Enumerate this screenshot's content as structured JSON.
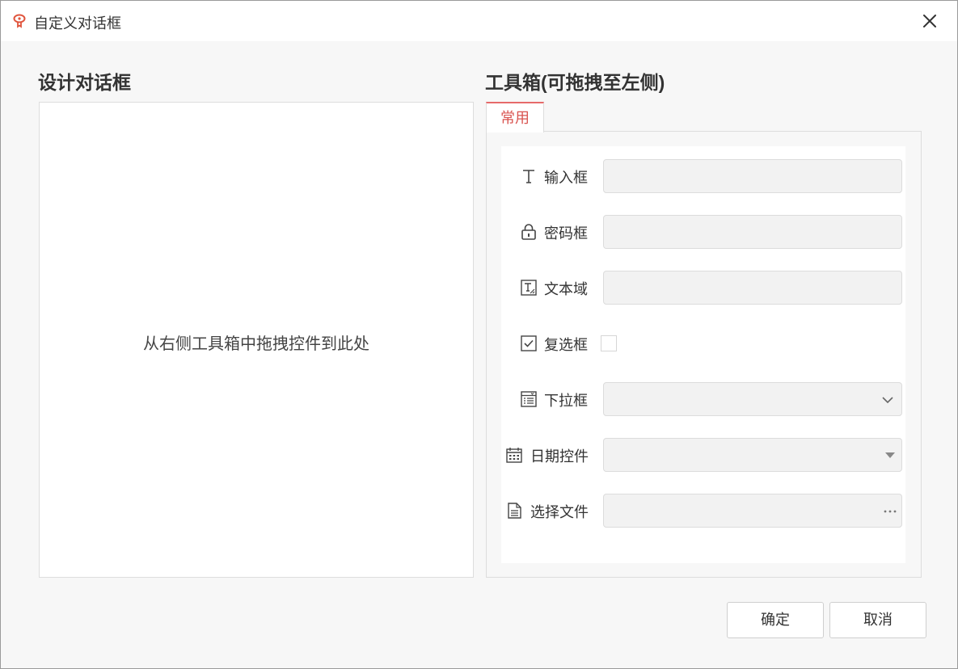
{
  "window": {
    "title": "自定义对话框"
  },
  "design": {
    "title": "设计对话框",
    "hint": "从右侧工具箱中拖拽控件到此处"
  },
  "toolbox": {
    "title": "工具箱(可拖拽至左侧)",
    "active_tab": "常用",
    "accent_color": "#e66a6a",
    "items": [
      {
        "label": "输入框",
        "icon": "text-T-icon"
      },
      {
        "label": "密码框",
        "icon": "lock-icon"
      },
      {
        "label": "文本域",
        "icon": "textarea-icon"
      },
      {
        "label": "复选框",
        "icon": "checkbox-icon"
      },
      {
        "label": "下拉框",
        "icon": "dropdown-list-icon"
      },
      {
        "label": "日期控件",
        "icon": "calendar-icon"
      },
      {
        "label": "选择文件",
        "icon": "file-icon"
      }
    ]
  },
  "footer": {
    "ok_label": "确定",
    "cancel_label": "取消"
  }
}
